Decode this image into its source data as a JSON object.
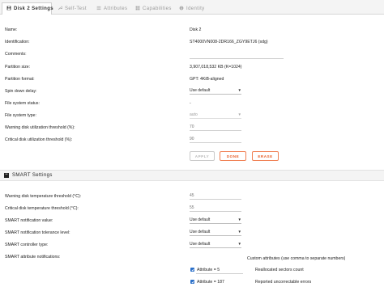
{
  "tabs": [
    {
      "label": "Disk 2 Settings",
      "icon": "floppy-icon",
      "active": true
    },
    {
      "label": "Self-Test",
      "icon": "wrench-icon",
      "active": false
    },
    {
      "label": "Attributes",
      "icon": "list-icon",
      "active": false
    },
    {
      "label": "Capabilities",
      "icon": "grid-icon",
      "active": false
    },
    {
      "label": "Identity",
      "icon": "info-icon",
      "active": false
    }
  ],
  "disk": {
    "name_label": "Name:",
    "name_value": "Disk 2",
    "identification_label": "Identification:",
    "identification_value": "ST4000VN008-2DR166_ZGY9ETJ6 (sdg)",
    "comments_label": "Comments:",
    "comments_value": "",
    "partition_size_label": "Partition size:",
    "partition_size_value": "3,907,018,532 KB (K=1024)",
    "partition_format_label": "Partition format:",
    "partition_format_value": "GPT: 4KiB-aligned",
    "spin_down_label": "Spin down delay:",
    "spin_down_value": "Use default",
    "fs_status_label": "File system status:",
    "fs_status_value": "-",
    "fs_type_label": "File system type:",
    "fs_type_value": "auto",
    "warn_util_label": "Warning disk utilization threshold (%):",
    "warn_util_placeholder": "70",
    "crit_util_label": "Critical disk utilization threshold (%):",
    "crit_util_placeholder": "90"
  },
  "buttons": {
    "apply": "APPLY",
    "done": "DONE",
    "erase": "ERASE"
  },
  "smart": {
    "section_title": "SMART Settings",
    "warn_temp_label": "Warning disk temperature threshold (°C):",
    "warn_temp_placeholder": "45",
    "crit_temp_label": "Critical disk temperature threshold (°C):",
    "crit_temp_placeholder": "55",
    "notif_value_label": "SMART notification value:",
    "notif_value": "Use default",
    "notif_tol_label": "SMART notification tolerance level:",
    "notif_tol_value": "Use default",
    "controller_label": "SMART controller type:",
    "controller_value": "Use default",
    "attr_notif_label": "SMART attribute notifications:",
    "custom_attr_label": "Custom attributes (use comma to separate numbers)",
    "attributes": [
      {
        "label": "Attribute = 5",
        "description": "Reallocated sectors count",
        "checked": true
      },
      {
        "label": "Attribute = 187",
        "description": "Reported uncorrectable errors",
        "checked": true
      }
    ]
  },
  "colors": {
    "accent": "#e8612c",
    "checkbox": "#2a6fc9"
  }
}
